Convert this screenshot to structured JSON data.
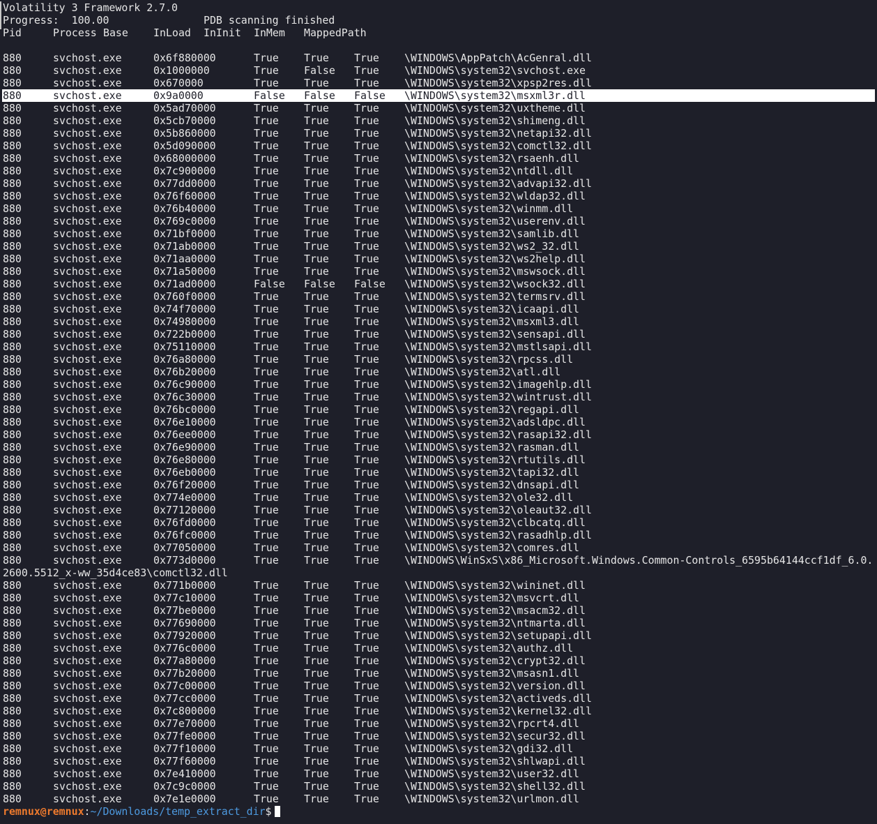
{
  "header": {
    "title": "Volatility 3 Framework 2.7.0",
    "progress": "Progress:  100.00\t\tPDB scanning finished",
    "columns": [
      "Pid",
      "Process",
      "Base",
      "InLoad",
      "InInit",
      "InMem",
      "MappedPath"
    ]
  },
  "rows": [
    {
      "pid": "880",
      "proc": "svchost.exe",
      "base": "0x6f880000",
      "inload": "True",
      "ininit": "True",
      "inmem": "True",
      "path": "\\WINDOWS\\AppPatch\\AcGenral.dll"
    },
    {
      "pid": "880",
      "proc": "svchost.exe",
      "base": "0x1000000",
      "inload": "True",
      "ininit": "False",
      "inmem": "True",
      "path": "\\WINDOWS\\system32\\svchost.exe"
    },
    {
      "pid": "880",
      "proc": "svchost.exe",
      "base": "0x670000",
      "inload": "True",
      "ininit": "True",
      "inmem": "True",
      "path": "\\WINDOWS\\system32\\xpsp2res.dll"
    },
    {
      "pid": "880",
      "proc": "svchost.exe",
      "base": "0x9a0000",
      "inload": "False",
      "ininit": "False",
      "inmem": "False",
      "path": "\\WINDOWS\\system32\\msxml3r.dll",
      "selected": true
    },
    {
      "pid": "880",
      "proc": "svchost.exe",
      "base": "0x5ad70000",
      "inload": "True",
      "ininit": "True",
      "inmem": "True",
      "path": "\\WINDOWS\\system32\\uxtheme.dll"
    },
    {
      "pid": "880",
      "proc": "svchost.exe",
      "base": "0x5cb70000",
      "inload": "True",
      "ininit": "True",
      "inmem": "True",
      "path": "\\WINDOWS\\system32\\shimeng.dll"
    },
    {
      "pid": "880",
      "proc": "svchost.exe",
      "base": "0x5b860000",
      "inload": "True",
      "ininit": "True",
      "inmem": "True",
      "path": "\\WINDOWS\\system32\\netapi32.dll"
    },
    {
      "pid": "880",
      "proc": "svchost.exe",
      "base": "0x5d090000",
      "inload": "True",
      "ininit": "True",
      "inmem": "True",
      "path": "\\WINDOWS\\system32\\comctl32.dll"
    },
    {
      "pid": "880",
      "proc": "svchost.exe",
      "base": "0x68000000",
      "inload": "True",
      "ininit": "True",
      "inmem": "True",
      "path": "\\WINDOWS\\system32\\rsaenh.dll"
    },
    {
      "pid": "880",
      "proc": "svchost.exe",
      "base": "0x7c900000",
      "inload": "True",
      "ininit": "True",
      "inmem": "True",
      "path": "\\WINDOWS\\system32\\ntdll.dll"
    },
    {
      "pid": "880",
      "proc": "svchost.exe",
      "base": "0x77dd0000",
      "inload": "True",
      "ininit": "True",
      "inmem": "True",
      "path": "\\WINDOWS\\system32\\advapi32.dll"
    },
    {
      "pid": "880",
      "proc": "svchost.exe",
      "base": "0x76f60000",
      "inload": "True",
      "ininit": "True",
      "inmem": "True",
      "path": "\\WINDOWS\\system32\\wldap32.dll"
    },
    {
      "pid": "880",
      "proc": "svchost.exe",
      "base": "0x76b40000",
      "inload": "True",
      "ininit": "True",
      "inmem": "True",
      "path": "\\WINDOWS\\system32\\winmm.dll"
    },
    {
      "pid": "880",
      "proc": "svchost.exe",
      "base": "0x769c0000",
      "inload": "True",
      "ininit": "True",
      "inmem": "True",
      "path": "\\WINDOWS\\system32\\userenv.dll"
    },
    {
      "pid": "880",
      "proc": "svchost.exe",
      "base": "0x71bf0000",
      "inload": "True",
      "ininit": "True",
      "inmem": "True",
      "path": "\\WINDOWS\\system32\\samlib.dll"
    },
    {
      "pid": "880",
      "proc": "svchost.exe",
      "base": "0x71ab0000",
      "inload": "True",
      "ininit": "True",
      "inmem": "True",
      "path": "\\WINDOWS\\system32\\ws2_32.dll"
    },
    {
      "pid": "880",
      "proc": "svchost.exe",
      "base": "0x71aa0000",
      "inload": "True",
      "ininit": "True",
      "inmem": "True",
      "path": "\\WINDOWS\\system32\\ws2help.dll"
    },
    {
      "pid": "880",
      "proc": "svchost.exe",
      "base": "0x71a50000",
      "inload": "True",
      "ininit": "True",
      "inmem": "True",
      "path": "\\WINDOWS\\system32\\mswsock.dll"
    },
    {
      "pid": "880",
      "proc": "svchost.exe",
      "base": "0x71ad0000",
      "inload": "False",
      "ininit": "False",
      "inmem": "False",
      "path": "\\WINDOWS\\system32\\wsock32.dll"
    },
    {
      "pid": "880",
      "proc": "svchost.exe",
      "base": "0x760f0000",
      "inload": "True",
      "ininit": "True",
      "inmem": "True",
      "path": "\\WINDOWS\\system32\\termsrv.dll"
    },
    {
      "pid": "880",
      "proc": "svchost.exe",
      "base": "0x74f70000",
      "inload": "True",
      "ininit": "True",
      "inmem": "True",
      "path": "\\WINDOWS\\system32\\icaapi.dll"
    },
    {
      "pid": "880",
      "proc": "svchost.exe",
      "base": "0x74980000",
      "inload": "True",
      "ininit": "True",
      "inmem": "True",
      "path": "\\WINDOWS\\system32\\msxml3.dll"
    },
    {
      "pid": "880",
      "proc": "svchost.exe",
      "base": "0x722b0000",
      "inload": "True",
      "ininit": "True",
      "inmem": "True",
      "path": "\\WINDOWS\\system32\\sensapi.dll"
    },
    {
      "pid": "880",
      "proc": "svchost.exe",
      "base": "0x75110000",
      "inload": "True",
      "ininit": "True",
      "inmem": "True",
      "path": "\\WINDOWS\\system32\\mstlsapi.dll"
    },
    {
      "pid": "880",
      "proc": "svchost.exe",
      "base": "0x76a80000",
      "inload": "True",
      "ininit": "True",
      "inmem": "True",
      "path": "\\WINDOWS\\system32\\rpcss.dll"
    },
    {
      "pid": "880",
      "proc": "svchost.exe",
      "base": "0x76b20000",
      "inload": "True",
      "ininit": "True",
      "inmem": "True",
      "path": "\\WINDOWS\\system32\\atl.dll"
    },
    {
      "pid": "880",
      "proc": "svchost.exe",
      "base": "0x76c90000",
      "inload": "True",
      "ininit": "True",
      "inmem": "True",
      "path": "\\WINDOWS\\system32\\imagehlp.dll"
    },
    {
      "pid": "880",
      "proc": "svchost.exe",
      "base": "0x76c30000",
      "inload": "True",
      "ininit": "True",
      "inmem": "True",
      "path": "\\WINDOWS\\system32\\wintrust.dll"
    },
    {
      "pid": "880",
      "proc": "svchost.exe",
      "base": "0x76bc0000",
      "inload": "True",
      "ininit": "True",
      "inmem": "True",
      "path": "\\WINDOWS\\system32\\regapi.dll"
    },
    {
      "pid": "880",
      "proc": "svchost.exe",
      "base": "0x76e10000",
      "inload": "True",
      "ininit": "True",
      "inmem": "True",
      "path": "\\WINDOWS\\system32\\adsldpc.dll"
    },
    {
      "pid": "880",
      "proc": "svchost.exe",
      "base": "0x76ee0000",
      "inload": "True",
      "ininit": "True",
      "inmem": "True",
      "path": "\\WINDOWS\\system32\\rasapi32.dll"
    },
    {
      "pid": "880",
      "proc": "svchost.exe",
      "base": "0x76e90000",
      "inload": "True",
      "ininit": "True",
      "inmem": "True",
      "path": "\\WINDOWS\\system32\\rasman.dll"
    },
    {
      "pid": "880",
      "proc": "svchost.exe",
      "base": "0x76e80000",
      "inload": "True",
      "ininit": "True",
      "inmem": "True",
      "path": "\\WINDOWS\\system32\\rtutils.dll"
    },
    {
      "pid": "880",
      "proc": "svchost.exe",
      "base": "0x76eb0000",
      "inload": "True",
      "ininit": "True",
      "inmem": "True",
      "path": "\\WINDOWS\\system32\\tapi32.dll"
    },
    {
      "pid": "880",
      "proc": "svchost.exe",
      "base": "0x76f20000",
      "inload": "True",
      "ininit": "True",
      "inmem": "True",
      "path": "\\WINDOWS\\system32\\dnsapi.dll"
    },
    {
      "pid": "880",
      "proc": "svchost.exe",
      "base": "0x774e0000",
      "inload": "True",
      "ininit": "True",
      "inmem": "True",
      "path": "\\WINDOWS\\system32\\ole32.dll"
    },
    {
      "pid": "880",
      "proc": "svchost.exe",
      "base": "0x77120000",
      "inload": "True",
      "ininit": "True",
      "inmem": "True",
      "path": "\\WINDOWS\\system32\\oleaut32.dll"
    },
    {
      "pid": "880",
      "proc": "svchost.exe",
      "base": "0x76fd0000",
      "inload": "True",
      "ininit": "True",
      "inmem": "True",
      "path": "\\WINDOWS\\system32\\clbcatq.dll"
    },
    {
      "pid": "880",
      "proc": "svchost.exe",
      "base": "0x76fc0000",
      "inload": "True",
      "ininit": "True",
      "inmem": "True",
      "path": "\\WINDOWS\\system32\\rasadhlp.dll"
    },
    {
      "pid": "880",
      "proc": "svchost.exe",
      "base": "0x77050000",
      "inload": "True",
      "ininit": "True",
      "inmem": "True",
      "path": "\\WINDOWS\\system32\\comres.dll"
    },
    {
      "pid": "880",
      "proc": "svchost.exe",
      "base": "0x773d0000",
      "inload": "True",
      "ininit": "True",
      "inmem": "True",
      "path": "\\WINDOWS\\WinSxS\\x86_Microsoft.Windows.Common-Controls_6595b64144ccf1df_6.0.",
      "wrap": "2600.5512_x-ww_35d4ce83\\comctl32.dll"
    },
    {
      "pid": "880",
      "proc": "svchost.exe",
      "base": "0x771b0000",
      "inload": "True",
      "ininit": "True",
      "inmem": "True",
      "path": "\\WINDOWS\\system32\\wininet.dll"
    },
    {
      "pid": "880",
      "proc": "svchost.exe",
      "base": "0x77c10000",
      "inload": "True",
      "ininit": "True",
      "inmem": "True",
      "path": "\\WINDOWS\\system32\\msvcrt.dll"
    },
    {
      "pid": "880",
      "proc": "svchost.exe",
      "base": "0x77be0000",
      "inload": "True",
      "ininit": "True",
      "inmem": "True",
      "path": "\\WINDOWS\\system32\\msacm32.dll"
    },
    {
      "pid": "880",
      "proc": "svchost.exe",
      "base": "0x77690000",
      "inload": "True",
      "ininit": "True",
      "inmem": "True",
      "path": "\\WINDOWS\\system32\\ntmarta.dll"
    },
    {
      "pid": "880",
      "proc": "svchost.exe",
      "base": "0x77920000",
      "inload": "True",
      "ininit": "True",
      "inmem": "True",
      "path": "\\WINDOWS\\system32\\setupapi.dll"
    },
    {
      "pid": "880",
      "proc": "svchost.exe",
      "base": "0x776c0000",
      "inload": "True",
      "ininit": "True",
      "inmem": "True",
      "path": "\\WINDOWS\\system32\\authz.dll"
    },
    {
      "pid": "880",
      "proc": "svchost.exe",
      "base": "0x77a80000",
      "inload": "True",
      "ininit": "True",
      "inmem": "True",
      "path": "\\WINDOWS\\system32\\crypt32.dll"
    },
    {
      "pid": "880",
      "proc": "svchost.exe",
      "base": "0x77b20000",
      "inload": "True",
      "ininit": "True",
      "inmem": "True",
      "path": "\\WINDOWS\\system32\\msasn1.dll"
    },
    {
      "pid": "880",
      "proc": "svchost.exe",
      "base": "0x77c00000",
      "inload": "True",
      "ininit": "True",
      "inmem": "True",
      "path": "\\WINDOWS\\system32\\version.dll"
    },
    {
      "pid": "880",
      "proc": "svchost.exe",
      "base": "0x77cc0000",
      "inload": "True",
      "ininit": "True",
      "inmem": "True",
      "path": "\\WINDOWS\\system32\\activeds.dll"
    },
    {
      "pid": "880",
      "proc": "svchost.exe",
      "base": "0x7c800000",
      "inload": "True",
      "ininit": "True",
      "inmem": "True",
      "path": "\\WINDOWS\\system32\\kernel32.dll"
    },
    {
      "pid": "880",
      "proc": "svchost.exe",
      "base": "0x77e70000",
      "inload": "True",
      "ininit": "True",
      "inmem": "True",
      "path": "\\WINDOWS\\system32\\rpcrt4.dll"
    },
    {
      "pid": "880",
      "proc": "svchost.exe",
      "base": "0x77fe0000",
      "inload": "True",
      "ininit": "True",
      "inmem": "True",
      "path": "\\WINDOWS\\system32\\secur32.dll"
    },
    {
      "pid": "880",
      "proc": "svchost.exe",
      "base": "0x77f10000",
      "inload": "True",
      "ininit": "True",
      "inmem": "True",
      "path": "\\WINDOWS\\system32\\gdi32.dll"
    },
    {
      "pid": "880",
      "proc": "svchost.exe",
      "base": "0x77f60000",
      "inload": "True",
      "ininit": "True",
      "inmem": "True",
      "path": "\\WINDOWS\\system32\\shlwapi.dll"
    },
    {
      "pid": "880",
      "proc": "svchost.exe",
      "base": "0x7e410000",
      "inload": "True",
      "ininit": "True",
      "inmem": "True",
      "path": "\\WINDOWS\\system32\\user32.dll"
    },
    {
      "pid": "880",
      "proc": "svchost.exe",
      "base": "0x7c9c0000",
      "inload": "True",
      "ininit": "True",
      "inmem": "True",
      "path": "\\WINDOWS\\system32\\shell32.dll"
    },
    {
      "pid": "880",
      "proc": "svchost.exe",
      "base": "0x7e1e0000",
      "inload": "True",
      "ininit": "True",
      "inmem": "True",
      "path": "\\WINDOWS\\system32\\urlmon.dll"
    }
  ],
  "prompt": {
    "user": "remnux@remnux",
    "sep": ":",
    "path": "~/Downloads/temp_extract_dir",
    "symbol": "$"
  },
  "colors": {
    "background": "#1e1f29",
    "text": "#e6e6e6",
    "prompt_user": "#ee7a2d",
    "prompt_path": "#4d9ae0",
    "selection": "#ffffff"
  }
}
